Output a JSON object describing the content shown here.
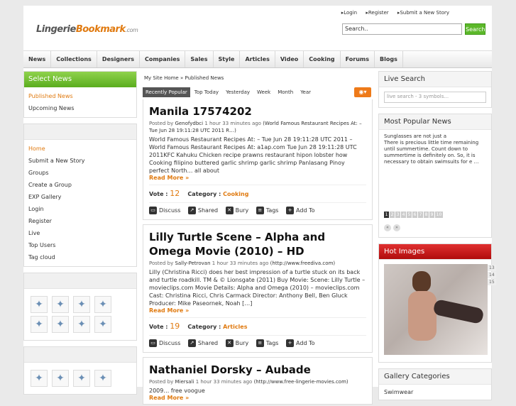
{
  "header": {
    "logo": {
      "part1": "Lingerie",
      "part2": "Bookmark",
      "part3": ".com"
    },
    "links": [
      "Login",
      "Register",
      "Submit a New Story"
    ],
    "search_value": "Search..",
    "search_button": "Search"
  },
  "nav": [
    "News",
    "Collections",
    "Designers",
    "Companies",
    "Sales",
    "Style",
    "Articles",
    "Video",
    "Cooking",
    "Forums",
    "Blogs"
  ],
  "left": {
    "select_news_title": "Select News",
    "news_items": [
      "Published News",
      "Upcoming News"
    ],
    "menu_items": [
      "Home",
      "Submit a New Story",
      "Groups",
      "Create a Group",
      "EXP Gallery",
      "Login",
      "Register",
      "Live",
      "Top Users",
      "Tag cloud"
    ]
  },
  "middle": {
    "breadcrumb": "My Site Home » Published News",
    "tabs": [
      "Recently Popular",
      "Top Today",
      "Yesterday",
      "Week",
      "Month",
      "Year"
    ],
    "rss_icon": "rss-icon",
    "stories": [
      {
        "title": "Manila 17574202",
        "meta_prefix": "Posted by",
        "author": "Genofydbci",
        "time": "1 hour 33 minutes ago",
        "source": "(World Famous Restaurant Recipes At: – Tue Jun 28 19:11:28 UTC 2011 R…)",
        "desc": "World Famous Restaurant Recipes At: – Tue Jun 28 19:11:28 UTC 2011 – World Famous Restaurant Recipes At: a1ap.com Tue Jun 28 19:11:28 UTC 2011KFC Kahuku Chicken recipe prawns restaurant hipon lobster how Cooking filipino buttered garlic shrimp garlic shrimp Panlasang Pinoy perfect North… all about",
        "more": "Read More »",
        "vote_label": "Vote :",
        "votes": "12",
        "category_label": "Category :",
        "category": "Cooking"
      },
      {
        "title": "Lilly Turtle Scene – Alpha and Omega Movie (2010) – HD",
        "meta_prefix": "Posted by",
        "author": "Sally-Petrovan",
        "time": "1 hour 33 minutes ago",
        "source": "(http://www.freediva.com)",
        "desc": "Lilly (Christina Ricci) does her best impression of a turtle stuck on its back and turtle roadkill. TM & © Lionsgate (2011) Buy Movie: Scene: Lilly Turtle – movieclips.com Movie Details: Alpha and Omega (2010) – movieclips.com Cast: Christina Ricci, Chris Carmack Director: Anthony Bell, Ben Gluck Producer: Mike Paseornek, Noah […]",
        "more": "Read More »",
        "vote_label": "Vote :",
        "votes": "19",
        "category_label": "Category :",
        "category": "Articles"
      },
      {
        "title": "Nathaniel Dorsky – Aubade",
        "meta_prefix": "Posted by",
        "author": "Miersali",
        "time": "1 hour 33 minutes ago",
        "source": "(http://www.free-lingerie-movies.com)",
        "desc": "2009… free voogue",
        "more": "Read More »"
      }
    ],
    "actions": [
      "Discuss",
      "Shared",
      "Bury",
      "Tags",
      "Add To"
    ]
  },
  "right": {
    "live_search_title": "Live Search",
    "live_search_placeholder": "live search - 3 symbols...",
    "popular_title": "Most Popular News",
    "popular_text": "Sunglasses are not just a\nThere is precious little time remaining until summertime.  Count down to summertime is definitely on.  So, it is necessary to obtain swimsuits for e …",
    "popular_pages": [
      "1",
      "2",
      "3",
      "4",
      "5",
      "6",
      "7",
      "8",
      "9",
      "10"
    ],
    "hot_images_title": "Hot Images",
    "hot_pages": [
      "13",
      "14",
      "15"
    ],
    "gallery_title": "Gallery Categories",
    "gallery_first": "Swimwear"
  },
  "colors": {
    "accent_orange": "#e07a10",
    "green": "#5cb82a",
    "red": "#c41414"
  }
}
